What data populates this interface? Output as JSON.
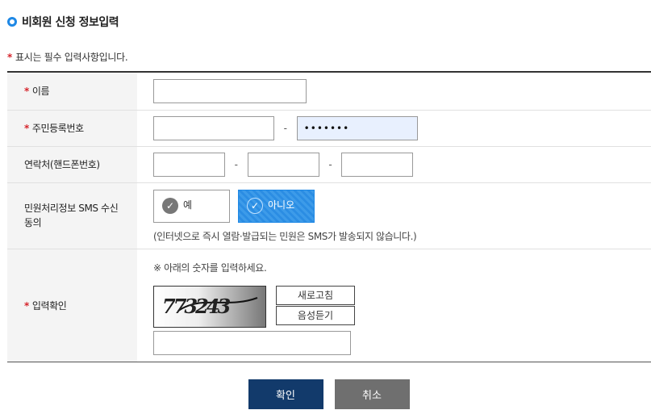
{
  "section": {
    "title": "비회원 신청 정보입력"
  },
  "required_note": {
    "mark": "*",
    "text": "표시는 필수 입력사항입니다."
  },
  "fields": {
    "name": {
      "required": true,
      "label": "이름",
      "value": ""
    },
    "rrn": {
      "required": true,
      "label": "주민등록번호",
      "front": "",
      "back_masked": "•••••••",
      "separator": "-"
    },
    "phone": {
      "required": false,
      "label": "연락처(핸드폰번호)",
      "part1": "",
      "part2": "",
      "part3": "",
      "separator": "-"
    },
    "sms": {
      "required": false,
      "label": "민원처리정보 SMS 수신동의",
      "options": [
        {
          "label": "예",
          "selected": false
        },
        {
          "label": "아니오",
          "selected": true
        }
      ],
      "description": "(인터넷으로 즉시 열람·발급되는 민원은 SMS가 발송되지 않습니다.)"
    },
    "captcha": {
      "required": true,
      "label": "입력확인",
      "instruction": "※ 아래의 숫자를 입력하세요.",
      "image_text": "773243",
      "refresh_label": "새로고침",
      "audio_label": "음성듣기",
      "value": ""
    }
  },
  "buttons": {
    "confirm": "확인",
    "cancel": "취소"
  },
  "colors": {
    "accent": "#1e88e5",
    "required": "#d6242b",
    "confirm_bg": "#123a6b",
    "cancel_bg": "#6f6f6f"
  }
}
